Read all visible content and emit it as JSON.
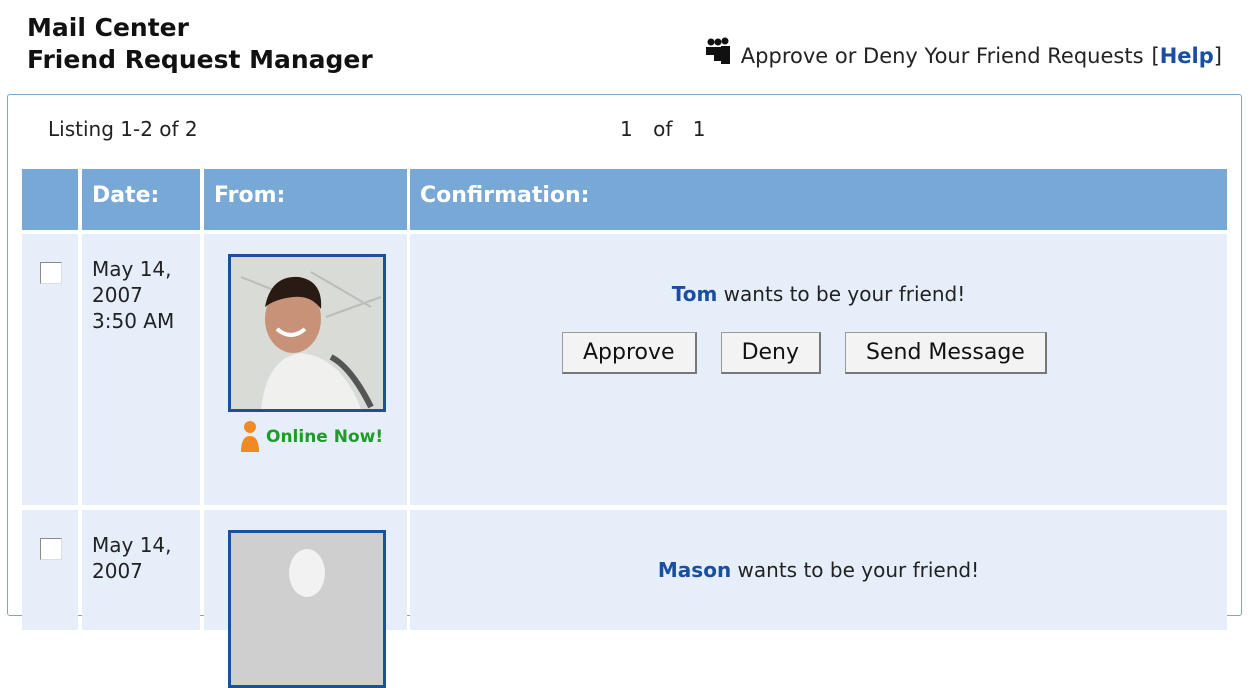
{
  "header": {
    "title_line1": "Mail Center",
    "title_line2": "Friend Request Manager",
    "subtitle": "Approve or Deny Your Friend Requests",
    "bracket_open": "[",
    "help_label": "Help",
    "bracket_close": "]"
  },
  "listing": {
    "range_text": "Listing 1-2 of 2",
    "page_current": "1",
    "page_of": "of",
    "page_total": "1"
  },
  "table": {
    "columns": [
      "",
      "Date:",
      "From:",
      "Confirmation:"
    ],
    "rows": [
      {
        "date_line1": "May 14,",
        "date_line2": "2007",
        "date_line3": "3:50 AM",
        "status": "Online Now!",
        "name": "Tom",
        "message": " wants to be your friend!",
        "buttons": [
          "Approve",
          "Deny",
          "Send Message"
        ]
      },
      {
        "date_line1": "May 14,",
        "date_line2": "2007",
        "name": "Mason",
        "message": " wants to be your friend!"
      }
    ]
  },
  "colors": {
    "header_bar": "#78a8d5",
    "row_bg": "#e6eff9",
    "link": "#1a4ea3",
    "online": "#1e9b2a"
  },
  "icons": [
    "people-icon",
    "online-status-icon",
    "checkbox",
    "avatar"
  ]
}
